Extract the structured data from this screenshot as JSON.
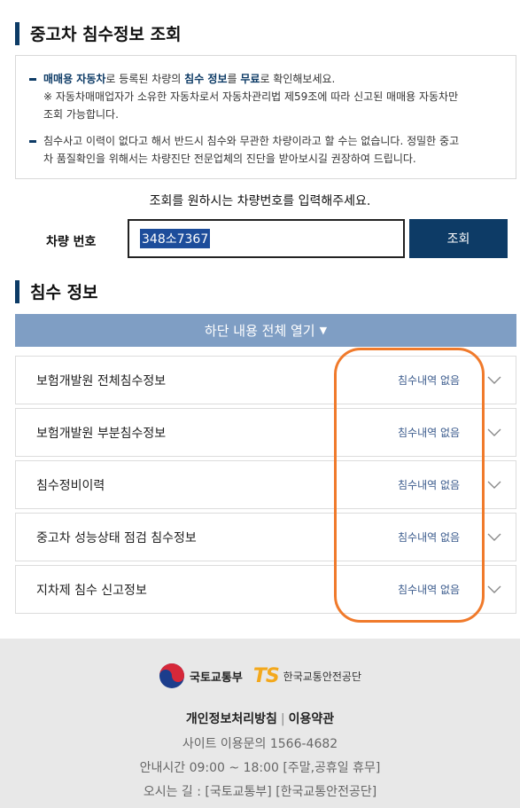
{
  "section1": {
    "title": "중고차 침수정보 조회"
  },
  "notice": {
    "p1_pre": "매매용 자동차",
    "p1_mid1": "로 등록된 차량의 ",
    "p1_bold2": "침수 정보",
    "p1_mid2": "를 ",
    "p1_bold3": "무료",
    "p1_end": "로 확인해보세요.",
    "p1_note1": "※ 자동차매매업자가 소유한 자동차로서 자동차관리법 제59조에 따라 신고된 매매용 자동차만",
    "p1_note2": "조회 가능합니다.",
    "p2_line1": "침수사고 이력이 없다고 해서 반드시 침수와 무관한 차량이라고 할 수는 없습니다. 정밀한 중고",
    "p2_line2": "차 품질확인을 위해서는 차량진단 전문업체의 진단을 받아보시길 권장하여 드립니다."
  },
  "search": {
    "prompt": "조회를 원하시는 차량번호를 입력해주세요.",
    "label": "차량 번호",
    "value": "348소7367",
    "button": "조회"
  },
  "section2": {
    "title": "침수 정보"
  },
  "open_all": {
    "label": "하단 내용 전체 열기",
    "arrow": "▼"
  },
  "rows": [
    {
      "title": "보험개발원 전체침수정보",
      "status": "침수내역 없음"
    },
    {
      "title": "보험개발원 부분침수정보",
      "status": "침수내역 없음"
    },
    {
      "title": "침수정비이력",
      "status": "침수내역 없음"
    },
    {
      "title": "중고차 성능상태 점검 침수정보",
      "status": "침수내역 없음"
    },
    {
      "title": "지차제 침수 신고정보",
      "status": "침수내역 없음"
    }
  ],
  "footer": {
    "logo1": "국토교통부",
    "logo2_ts": "TS",
    "logo2": "한국교통안전공단",
    "privacy": "개인정보처리방침",
    "sep": "|",
    "terms": "이용약관",
    "phone": "사이트 이용문의 1566-4682",
    "hours": "안내시간 09:00 ~ 18:00 [주말,공휴일 휴무]",
    "directions_label": "오시는 길 :",
    "dir1": "[국토교통부]",
    "dir2": "[한국교통안전공단]"
  },
  "colors": {
    "navy": "#0d3b66",
    "accent_bar": "#7f9ec4",
    "highlight": "#f07a2b"
  }
}
